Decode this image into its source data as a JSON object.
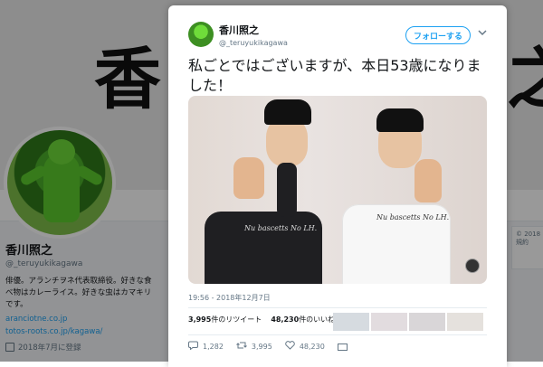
{
  "profile": {
    "banner_text": "香",
    "banner_text_right": "之",
    "name": "香川照之",
    "handle": "@_teruyukikagawa",
    "bio": "俳優。アランチヲネ代表取締役。好きな食べ物はカレーライス。好きな虫はカマキリです。",
    "link1": "aranciotne.co.jp",
    "link2": "totos-roots.co.jp/kagawa/",
    "joined": "2018年7月に登録"
  },
  "side_card": {
    "text": "© 2018 規約"
  },
  "tweet": {
    "name": "香川照之",
    "handle": "@_teruyukikagawa",
    "follow_label": "フォローする",
    "text": "私ごとではございますが、本日53歳になりました！",
    "shirt_text": "Nu bascetts No LH.",
    "timestamp": "19:56 - 2018年12月7日",
    "retweets_count": "3,995",
    "retweets_label": "件のリツイート",
    "likes_count": "48,230",
    "likes_label": "件のいいね",
    "reply_count": "1,282",
    "retweet_count": "3,995",
    "like_count": "48,230"
  },
  "icons": {
    "reply": "comment-icon",
    "retweet": "retweet-icon",
    "like": "heart-icon",
    "dm": "mail-icon",
    "more": "chevron-down-icon"
  },
  "colors": {
    "accent": "#1da1f2",
    "text": "#14171a",
    "muted": "#657786"
  }
}
